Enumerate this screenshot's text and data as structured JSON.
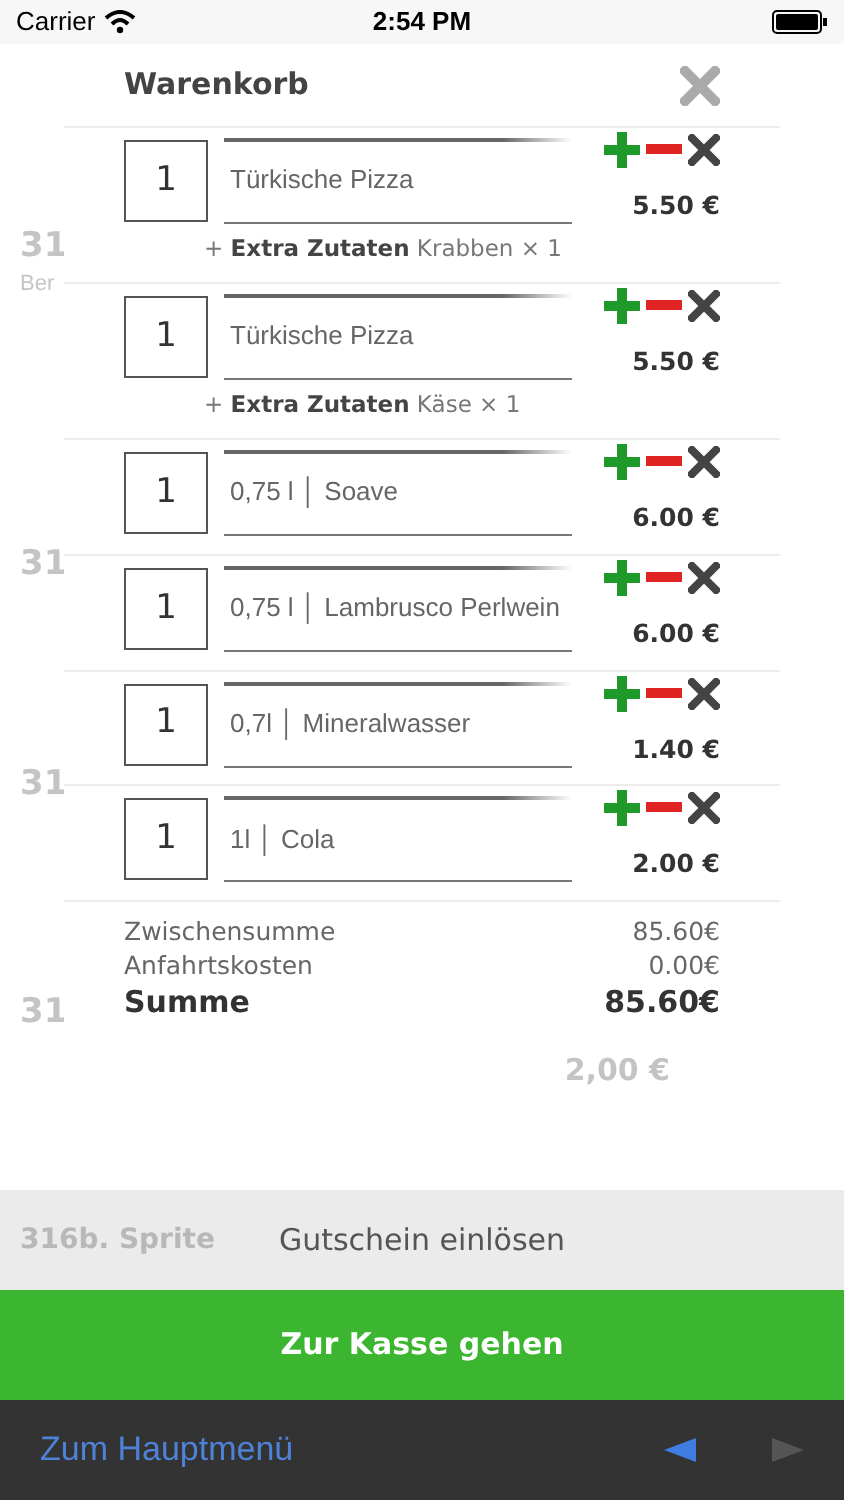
{
  "status_bar": {
    "carrier": "Carrier",
    "time": "2:54 PM"
  },
  "background_items": [
    {
      "number": "31",
      "subtitle": "Ber"
    },
    {
      "number": "31"
    },
    {
      "number": "31"
    },
    {
      "number": "31"
    }
  ],
  "cart": {
    "title": "Warenkorb",
    "items": [
      {
        "quantity": "1",
        "name": "Türkische Pizza",
        "price": "5.50 €",
        "extra": "+ **Extra Zutaten** Krabben × 1"
      },
      {
        "quantity": "1",
        "name": "Türkische Pizza",
        "price": "5.50 €",
        "extra": "+ **Extra Zutaten** Käse × 1"
      },
      {
        "quantity": "1",
        "name": "0,75 l │ Soave",
        "price": "6.00 €"
      },
      {
        "quantity": "1",
        "name": "0,75 l │ Lambrusco Perlwein",
        "price": "6.00 €"
      },
      {
        "quantity": "1",
        "name": "0,7l │ Mineralwasser",
        "price": "1.40 €"
      },
      {
        "quantity": "1",
        "name": "1l │ Cola",
        "price": "2.00 €"
      }
    ],
    "totals": [
      {
        "label": "Zwischensumme",
        "value": "85.60€",
        "bold": false
      },
      {
        "label": "Anfahrtskosten",
        "value": "0.00€",
        "bold": false
      },
      {
        "label": "Summe",
        "value": "85.60€",
        "bold": true
      }
    ],
    "background_price": "2,00 €"
  },
  "voucher": {
    "label": "Gutschein einlösen",
    "background_text": "316b. Sprite"
  },
  "checkout": {
    "label": "Zur Kasse gehen"
  },
  "nav": {
    "label": "Zum Hauptmenü",
    "back_enabled": true,
    "forward_enabled": false
  }
}
